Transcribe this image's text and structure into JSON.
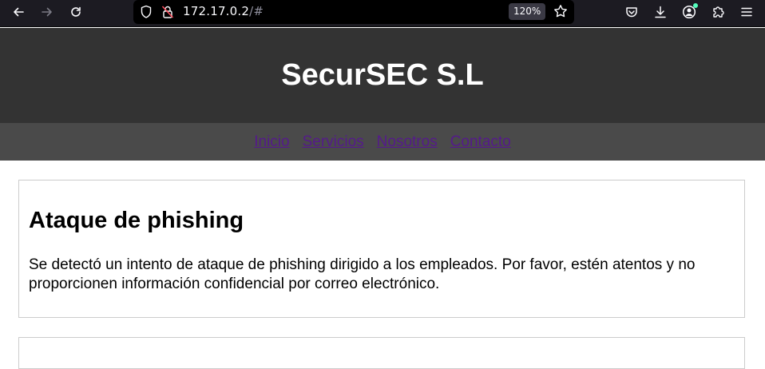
{
  "browser": {
    "url_host": "172.17.0.2",
    "url_hash": "/#",
    "zoom": "120%",
    "icons": {
      "back": "arrow-left-icon",
      "forward": "arrow-right-icon",
      "reload": "reload-icon",
      "tracking": "shield-icon",
      "insecure": "lock-insecure-icon",
      "bookmark": "star-icon",
      "pocket": "pocket-icon",
      "downloads": "download-icon",
      "account": "account-icon",
      "extensions": "puzzle-icon",
      "menu": "hamburger-menu-icon"
    }
  },
  "site": {
    "title": "SecurSEC S.L",
    "nav": [
      "Inicio",
      "Servicios",
      "Nosotros",
      "Contacto"
    ]
  },
  "posts": [
    {
      "title": "Ataque de phishing",
      "body": "Se detectó un intento de ataque de phishing dirigido a los empleados. Por favor, estén atentos y no proporcionen información confidencial por correo electrónico."
    }
  ],
  "colors": {
    "header_bg": "#333333",
    "nav_bg": "#4a4a4a",
    "link": "#551a8b"
  }
}
